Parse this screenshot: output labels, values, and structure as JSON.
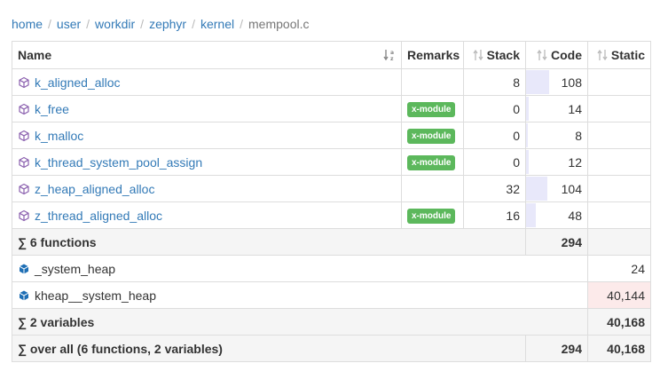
{
  "breadcrumb": {
    "items": [
      "home",
      "user",
      "workdir",
      "zephyr",
      "kernel"
    ],
    "current": "mempool.c"
  },
  "headers": {
    "name": "Name",
    "remarks": "Remarks",
    "stack": "Stack",
    "code": "Code",
    "static": "Static"
  },
  "functions": [
    {
      "name": "k_aligned_alloc",
      "remark": "",
      "stack": "8",
      "code": "108",
      "code_fraction": 0.37
    },
    {
      "name": "k_free",
      "remark": "x-module",
      "stack": "0",
      "code": "14",
      "code_fraction": 0.05
    },
    {
      "name": "k_malloc",
      "remark": "x-module",
      "stack": "0",
      "code": "8",
      "code_fraction": 0.03
    },
    {
      "name": "k_thread_system_pool_assign",
      "remark": "x-module",
      "stack": "0",
      "code": "12",
      "code_fraction": 0.04
    },
    {
      "name": "z_heap_aligned_alloc",
      "remark": "",
      "stack": "32",
      "code": "104",
      "code_fraction": 0.35
    },
    {
      "name": "z_thread_aligned_alloc",
      "remark": "x-module",
      "stack": "16",
      "code": "48",
      "code_fraction": 0.16
    }
  ],
  "functions_summary": {
    "label": "6 functions",
    "code": "294"
  },
  "variables": [
    {
      "name": "_system_heap",
      "static": "24"
    },
    {
      "name": "kheap__system_heap",
      "static": "40,144"
    }
  ],
  "variables_summary": {
    "label": "2 variables",
    "static": "40,168"
  },
  "overall": {
    "label": "over all (6 functions, 2 variables)",
    "code": "294",
    "static": "40,168"
  },
  "icons": {
    "function": "function-cube-icon",
    "variable": "variable-cube-icon",
    "sum": "sigma-icon"
  },
  "colors": {
    "link": "#337ab7",
    "badge": "#5cb85c",
    "bar": "#e8e8fa",
    "hot": "#fceaea"
  }
}
